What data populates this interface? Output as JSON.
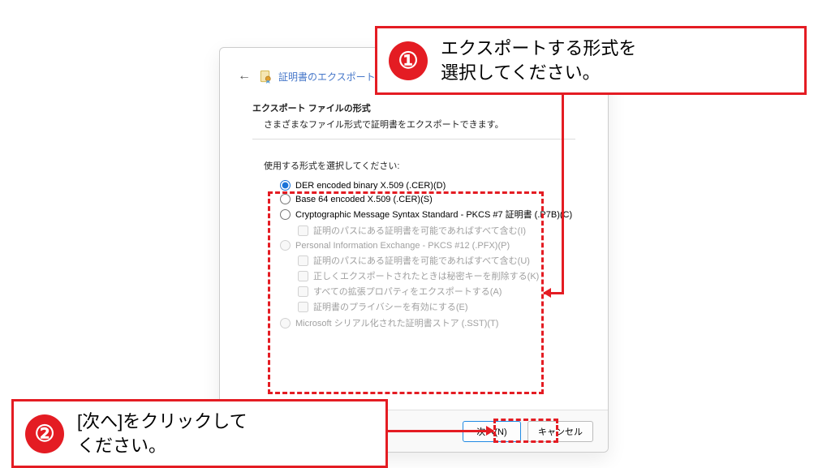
{
  "dialog": {
    "title_text": "証明書のエクスポート ウィザード",
    "section_title": "エクスポート ファイルの形式",
    "section_desc": "さまざまなファイル形式で証明書をエクスポートできます。",
    "instruction": "使用する形式を選択してください:",
    "options": {
      "der": "DER encoded binary X.509 (.CER)(D)",
      "base64": "Base 64 encoded X.509 (.CER)(S)",
      "pkcs7": "Cryptographic Message Syntax Standard - PKCS #7 証明書 (.P7B)(C)",
      "pkcs7_chk1": "証明のパスにある証明書を可能であればすべて含む(I)",
      "pfx": "Personal Information Exchange - PKCS #12 (.PFX)(P)",
      "pfx_chk1": "証明のパスにある証明書を可能であればすべて含む(U)",
      "pfx_chk2": "正しくエクスポートされたときは秘密キーを削除する(K)",
      "pfx_chk3": "すべての拡張プロパティをエクスポートする(A)",
      "pfx_chk4": "証明書のプライバシーを有効にする(E)",
      "sst": "Microsoft シリアル化された証明書ストア (.SST)(T)"
    },
    "buttons": {
      "next": "次へ(N)",
      "cancel": "キャンセル"
    }
  },
  "callouts": {
    "c1": {
      "num": "①",
      "text": "エクスポートする形式を\n選択してください。"
    },
    "c2": {
      "num": "②",
      "text": "[次へ]をクリックして\nください。"
    }
  }
}
